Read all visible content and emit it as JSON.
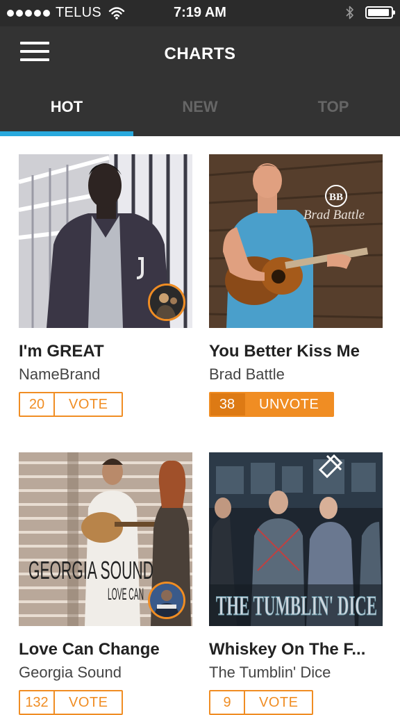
{
  "status_bar": {
    "carrier": "TELUS",
    "time": "7:19 AM",
    "signal_dots": 5,
    "wifi_icon": "wifi-icon",
    "bluetooth_icon": "bluetooth-icon",
    "battery_level": 0.95
  },
  "header": {
    "title": "CHARTS",
    "menu_icon": "hamburger-menu-icon"
  },
  "tabs": [
    {
      "label": "HOT",
      "active": true
    },
    {
      "label": "NEW",
      "active": false
    },
    {
      "label": "TOP",
      "active": false
    }
  ],
  "colors": {
    "header_bg": "#333333",
    "tab_indicator": "#29a9dd",
    "accent": "#f08d23"
  },
  "songs": [
    {
      "title": "I'm GREAT",
      "artist": "NameBrand",
      "votes": "20",
      "action": "VOTE",
      "voted": false
    },
    {
      "title": "You Better Kiss Me",
      "artist": "Brad Battle",
      "votes": "38",
      "action": "UNVOTE",
      "voted": true,
      "cover_text": "Brad Battle",
      "cover_logo": "BB"
    },
    {
      "title": "Love Can Change",
      "artist": "Georgia Sound",
      "votes": "132",
      "action": "VOTE",
      "voted": false,
      "cover_text": "GEORGIA SOUND",
      "cover_subtext": "LOVE CAN"
    },
    {
      "title": "Whiskey On The F...",
      "artist": "The Tumblin' Dice",
      "votes": "9",
      "action": "VOTE",
      "voted": false,
      "cover_text": "THE TUMBLIN' DICE"
    }
  ]
}
